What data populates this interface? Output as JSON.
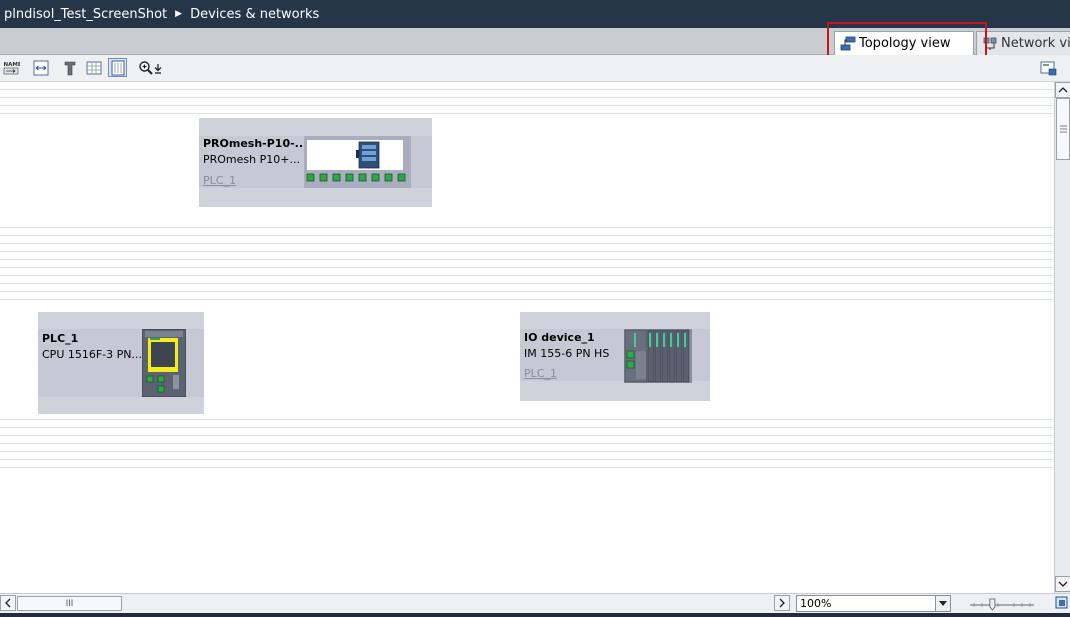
{
  "title_bar": {
    "project": "plndisol_Test_ScreenShot",
    "separator_icon": "triangle-right-icon",
    "section": "Devices & networks"
  },
  "tabs": [
    {
      "label": "Topology view",
      "icon": "topology-view-icon",
      "active": true
    },
    {
      "label": "Network view",
      "icon": "network-view-icon",
      "active": false
    }
  ],
  "toolbar": {
    "buttons": [
      {
        "icon": "show-name-icon",
        "glyph": "NAME"
      },
      {
        "icon": "fit-to-window-icon"
      },
      {
        "icon": "flag-icon"
      },
      {
        "icon": "grid-table-icon"
      },
      {
        "icon": "page-view-icon",
        "pressed": true
      },
      {
        "icon": "zoom-in-icon"
      },
      {
        "icon": "zoom-dropdown-icon"
      }
    ],
    "right_icon": "overview-panel-icon"
  },
  "devices": [
    {
      "name": "PROmesh-P10-...",
      "type": "PROmesh P10+...",
      "link": "PLC_1",
      "image": "switch-device-icon",
      "ports_shown": 8
    },
    {
      "name": "PLC_1",
      "type": "CPU 1516F-3 PN...",
      "link": "",
      "image": "plc-cpu-icon"
    },
    {
      "name": "IO device_1",
      "type": "IM 155-6 PN HS",
      "link": "PLC_1",
      "image": "io-module-icon"
    }
  ],
  "status": {
    "zoom_value": "100%",
    "scroll_thumb_glyph": "III",
    "zoom_slider_position": 0.35
  },
  "colors": {
    "title_bg": "#263649",
    "highlight": "#c4161c",
    "device_bg": "#cfd2db",
    "port_green": "#2fa84a"
  }
}
